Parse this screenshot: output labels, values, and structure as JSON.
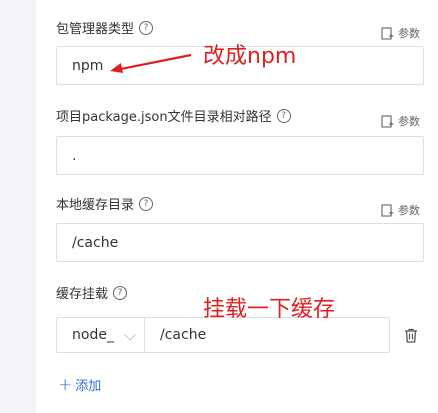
{
  "fields": {
    "package_manager": {
      "label": "包管理器类型",
      "value": "npm",
      "param_label": "参数"
    },
    "package_json_path": {
      "label": "项目package.json文件目录相对路径",
      "value": ".",
      "param_label": "参数"
    },
    "local_cache_dir": {
      "label": "本地缓存目录",
      "value": "/cache",
      "param_label": "参数"
    },
    "cache_mount": {
      "label": "缓存挂载",
      "select_value": "node_",
      "path_value": "/cache"
    }
  },
  "add_button": {
    "plus": "+",
    "label": "添加"
  },
  "annotations": {
    "change_to_npm": "改成npm",
    "mount_cache": "挂载一下缓存"
  },
  "colors": {
    "annotation": "#e02020",
    "link": "#2f6fd6",
    "border": "#dcdfe6"
  },
  "icons": [
    "help-circle-icon",
    "param-edit-icon",
    "chevron-down-icon",
    "trash-icon",
    "plus-icon"
  ]
}
